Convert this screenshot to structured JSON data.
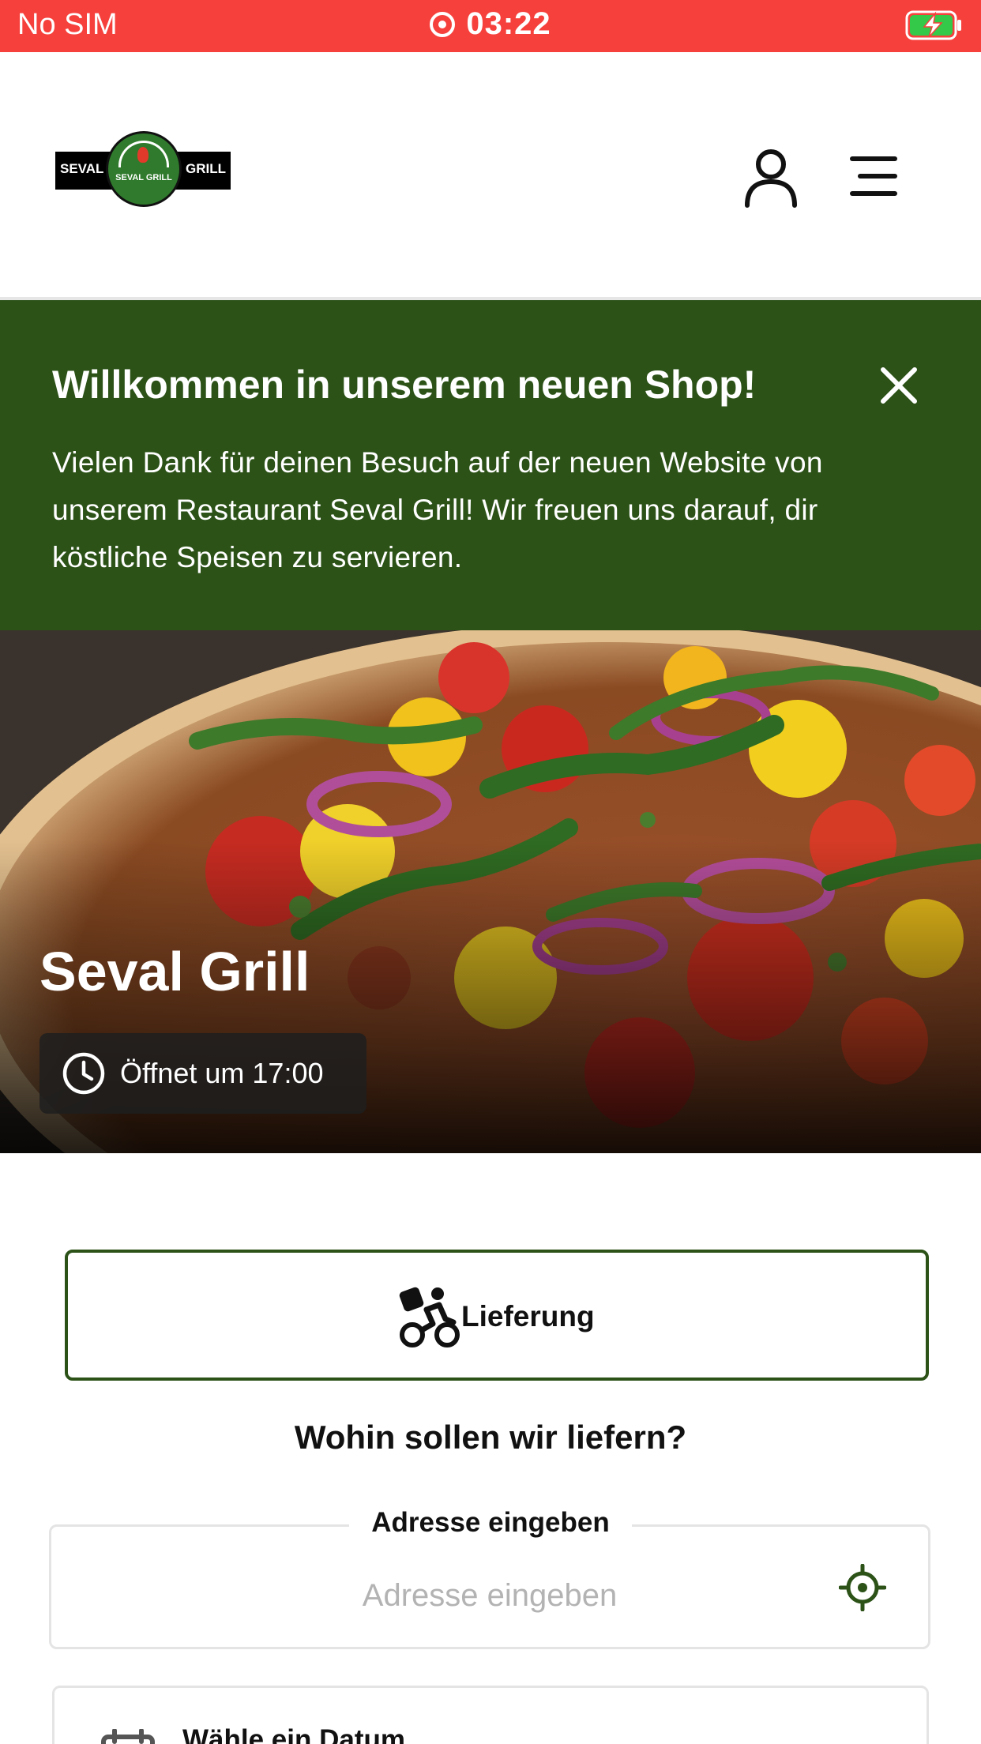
{
  "status_bar": {
    "carrier": "No SIM",
    "time": "03:22",
    "icons": [
      "screen-record-icon",
      "battery-charging-icon"
    ]
  },
  "header": {
    "logo": {
      "left_text": "SEVAL",
      "center_text": "SEVAL GRILL",
      "right_text": "GRILL"
    },
    "icons": [
      "user-icon",
      "menu-icon"
    ]
  },
  "banner": {
    "title": "Willkommen in unserem neuen Shop!",
    "text": "Vielen Dank für deinen Besuch auf der neuen Website von unserem Restaurant Seval Grill! Wir freuen uns darauf, dir köstliche Speisen zu servieren.",
    "close_icon": "close-icon"
  },
  "hero": {
    "title": "Seval Grill",
    "hours": "Öffnet um 17:00",
    "clock_icon": "clock-icon"
  },
  "delivery": {
    "label": "Lieferung",
    "icon": "delivery-bike-icon"
  },
  "address": {
    "question": "Wohin sollen wir liefern?",
    "legend": "Adresse eingeben",
    "placeholder": "Adresse eingeben",
    "value": "",
    "icon": "crosshair-location-icon"
  },
  "date": {
    "label": "Wähle ein Datum",
    "icon": "calendar-icon"
  },
  "colors": {
    "status_bar": "#f6403c",
    "brand_green": "#2c5218",
    "logo_green": "#2f7a2c"
  }
}
